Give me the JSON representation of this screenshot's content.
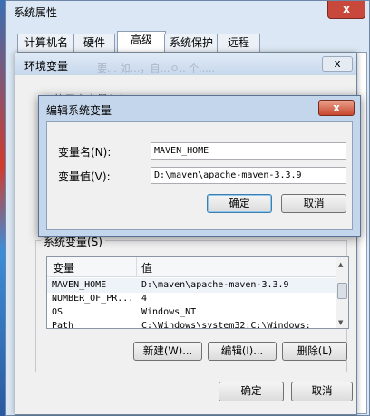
{
  "system_properties": {
    "title": "系统属性",
    "close_glyph": "x",
    "tabs": [
      "计算机名",
      "硬件",
      "高级",
      "系统保护",
      "远程"
    ]
  },
  "env_dialog": {
    "title": "环境变量",
    "close_glyph": "x",
    "blurred_note": "要…  如…，自…ㅇ.. 个..…",
    "user_group_label": "…的用户变量(U)",
    "system_group_label": "系统变量(S)",
    "list": {
      "col_variable": "变量",
      "col_value": "值",
      "rows": [
        {
          "name": "MAVEN_HOME",
          "value": "D:\\maven\\apache-maven-3.3.9"
        },
        {
          "name": "NUMBER_OF_PR...",
          "value": "4"
        },
        {
          "name": "OS",
          "value": "Windows_NT"
        },
        {
          "name": "Path",
          "value": "C:\\Windows\\system32;C:\\Windows;"
        }
      ]
    },
    "buttons": {
      "new": "新建(W)...",
      "edit": "编辑(I)...",
      "delete": "删除(L)",
      "ok": "确定",
      "cancel": "取消"
    }
  },
  "edit_dialog": {
    "title": "编辑系统变量",
    "close_glyph": "x",
    "name_label": "变量名(N):",
    "value_label": "变量值(V):",
    "name_value": "MAVEN_HOME",
    "value_value": "D:\\maven\\apache-maven-3.3.9",
    "ok": "确定",
    "cancel": "取消"
  },
  "colors": {
    "close_red": "#c8452e",
    "default_button_border": "#3c7fb1"
  }
}
